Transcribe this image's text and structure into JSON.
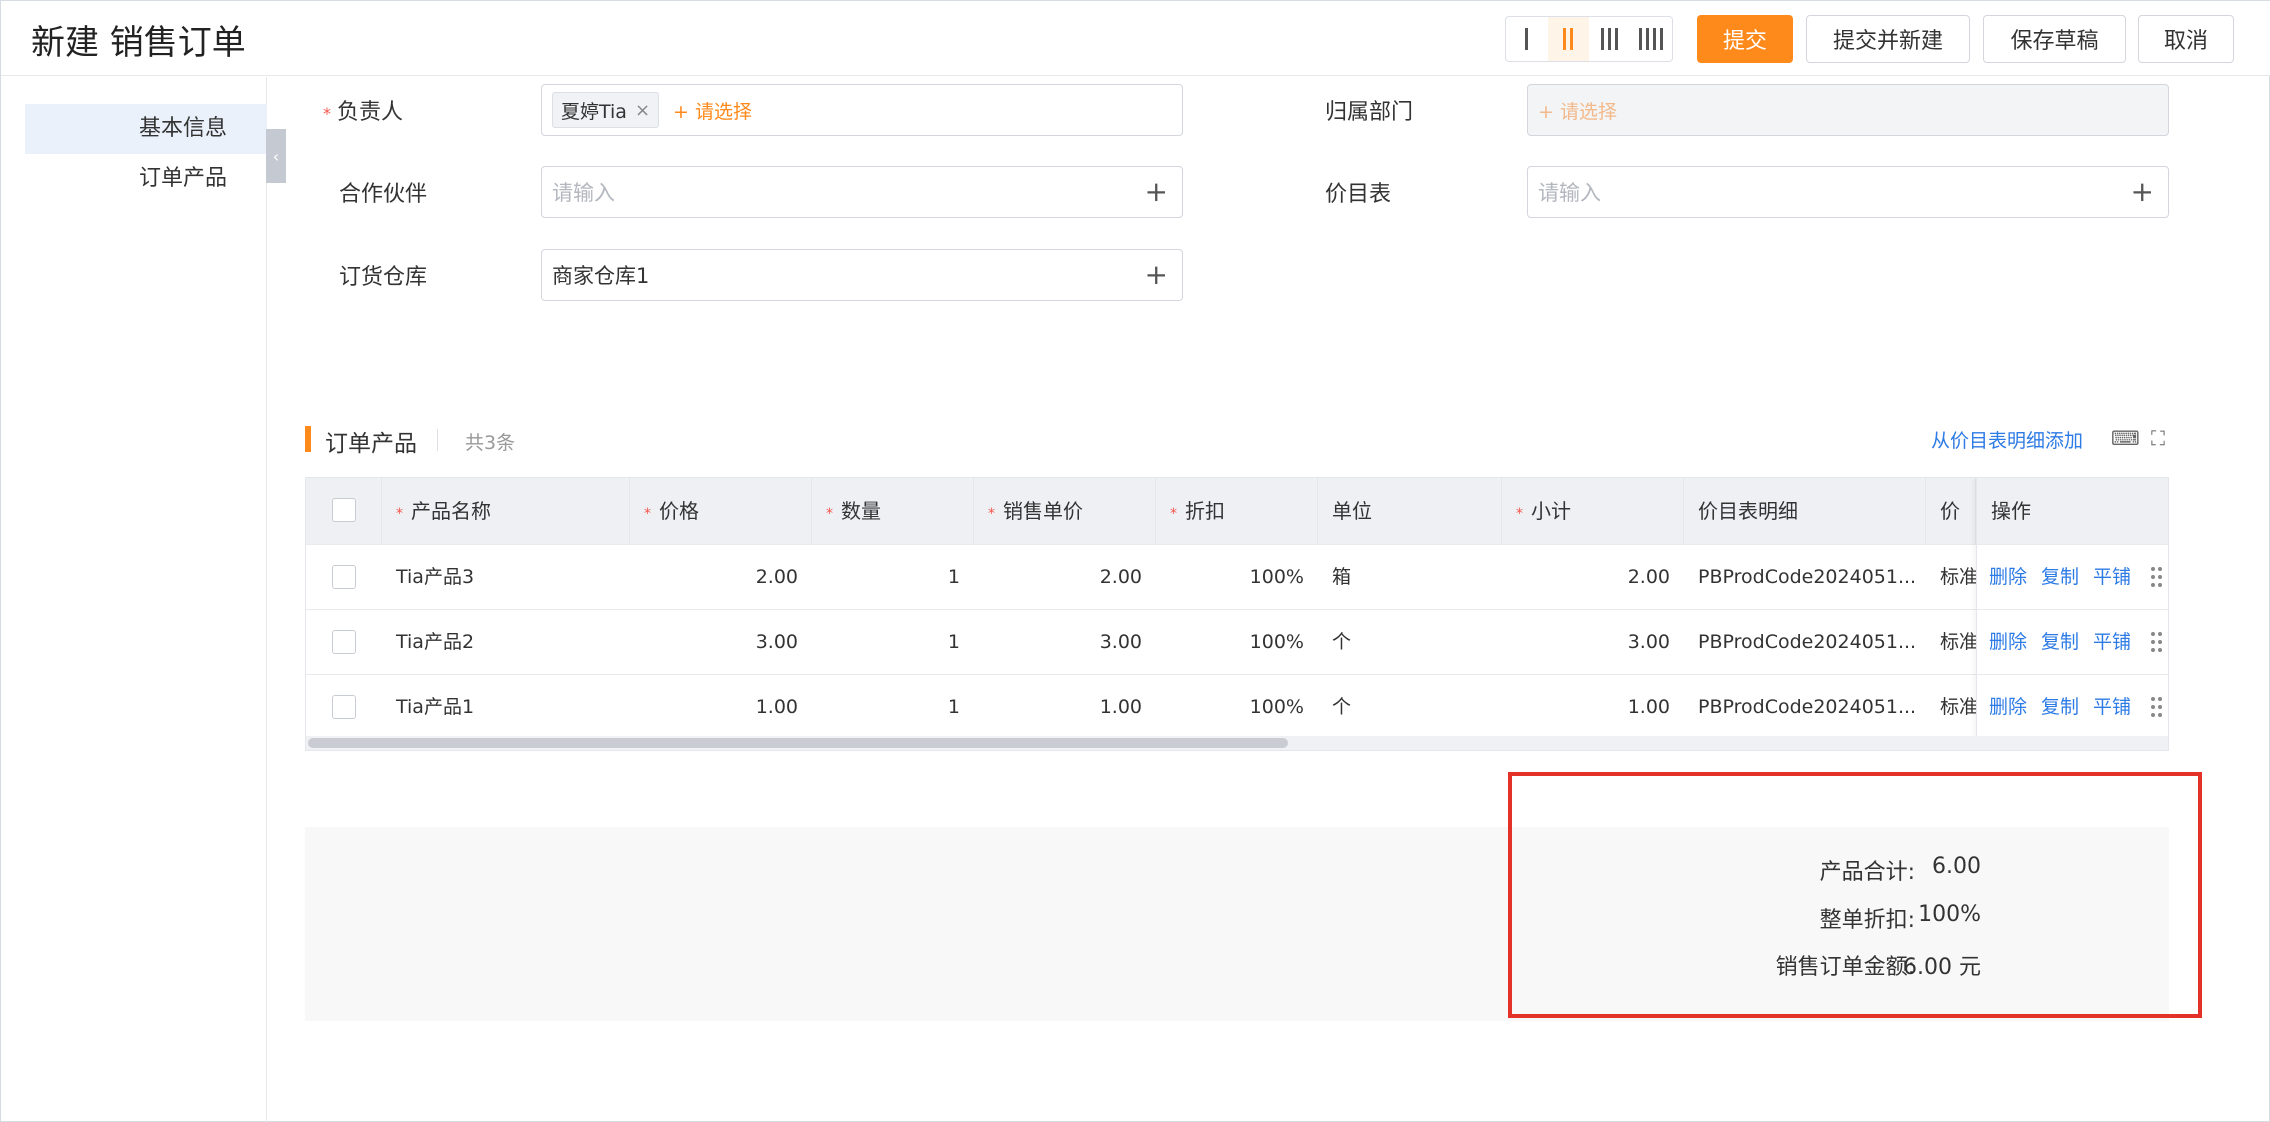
{
  "header": {
    "title": "新建 销售订单",
    "buttons": {
      "submit": "提交",
      "submit_new": "提交并新建",
      "save_draft": "保存草稿",
      "cancel": "取消"
    }
  },
  "sidebar": {
    "items": [
      {
        "label": "基本信息"
      },
      {
        "label": "订单产品"
      }
    ]
  },
  "form": {
    "owner": {
      "label": "负责人",
      "tag": "夏婷Tia",
      "select": "+ 请选择"
    },
    "department": {
      "label": "归属部门",
      "select": "+ 请选择"
    },
    "partner": {
      "label": "合作伙伴",
      "placeholder": "请输入"
    },
    "pricebook": {
      "label": "价目表",
      "placeholder": "请输入"
    },
    "warehouse": {
      "label": "订货仓库",
      "value": "商家仓库1"
    }
  },
  "products": {
    "title": "订单产品",
    "count": "共3条",
    "add_from_pricebook": "从价目表明细添加",
    "columns": [
      "产品名称",
      "价格",
      "数量",
      "销售单价",
      "折扣",
      "单位",
      "小计",
      "价目表明细",
      "价目表",
      "操作"
    ],
    "rows": [
      {
        "name": "Tia产品3",
        "price": "2.00",
        "qty": "1",
        "unit_price": "2.00",
        "discount": "100%",
        "unit": "箱",
        "subtotal": "2.00",
        "pb_detail": "PBProdCode2024051...",
        "pb": "标准价"
      },
      {
        "name": "Tia产品2",
        "price": "3.00",
        "qty": "1",
        "unit_price": "3.00",
        "discount": "100%",
        "unit": "个",
        "subtotal": "3.00",
        "pb_detail": "PBProdCode2024051...",
        "pb": "标准价"
      },
      {
        "name": "Tia产品1",
        "price": "1.00",
        "qty": "1",
        "unit_price": "1.00",
        "discount": "100%",
        "unit": "个",
        "subtotal": "1.00",
        "pb_detail": "PBProdCode2024051...",
        "pb": "标准价"
      }
    ],
    "ops": {
      "delete": "删除",
      "copy": "复制",
      "tile": "平铺"
    }
  },
  "summary": {
    "product_total_label": "产品合计:",
    "product_total": "6.00",
    "order_discount_label": "整单折扣:",
    "order_discount": "100%",
    "order_amount_label": "销售订单金额:",
    "order_amount": "6.00 元"
  },
  "colors": {
    "accent": "#ff8a1c",
    "link": "#2d7be5",
    "highlight": "#e53228"
  }
}
